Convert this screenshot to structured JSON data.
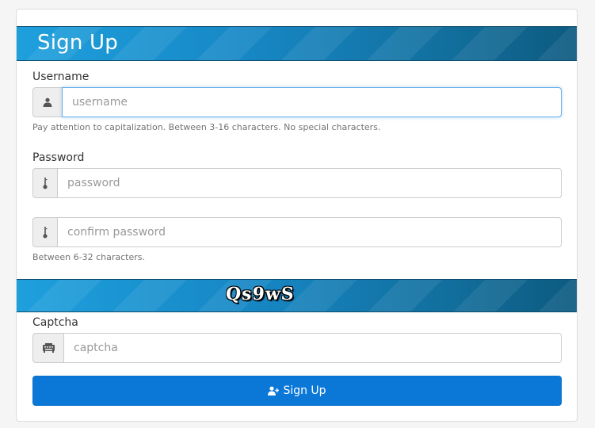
{
  "form": {
    "title": "Sign Up",
    "username": {
      "label": "Username",
      "icon": "user-icon",
      "placeholder": "username",
      "value": "",
      "help": "Pay attention to capitalization. Between 3-16 characters. No special characters."
    },
    "password": {
      "label": "Password",
      "icon": "key-icon",
      "placeholder": "password",
      "value": ""
    },
    "confirm_password": {
      "icon": "key-icon",
      "placeholder": "confirm password",
      "value": "",
      "help": "Between 6-32 characters."
    },
    "captcha": {
      "image_text": "Qs9wS",
      "label": "Captcha",
      "icon": "keyboard-icon",
      "placeholder": "captcha",
      "value": ""
    },
    "submit": {
      "label": "Sign Up",
      "icon": "user-add-icon"
    }
  },
  "colors": {
    "banner_start": "#1ea0dd",
    "banner_end": "#0d5a80",
    "primary_button": "#0b78d8",
    "focus_border": "#66afe9"
  }
}
